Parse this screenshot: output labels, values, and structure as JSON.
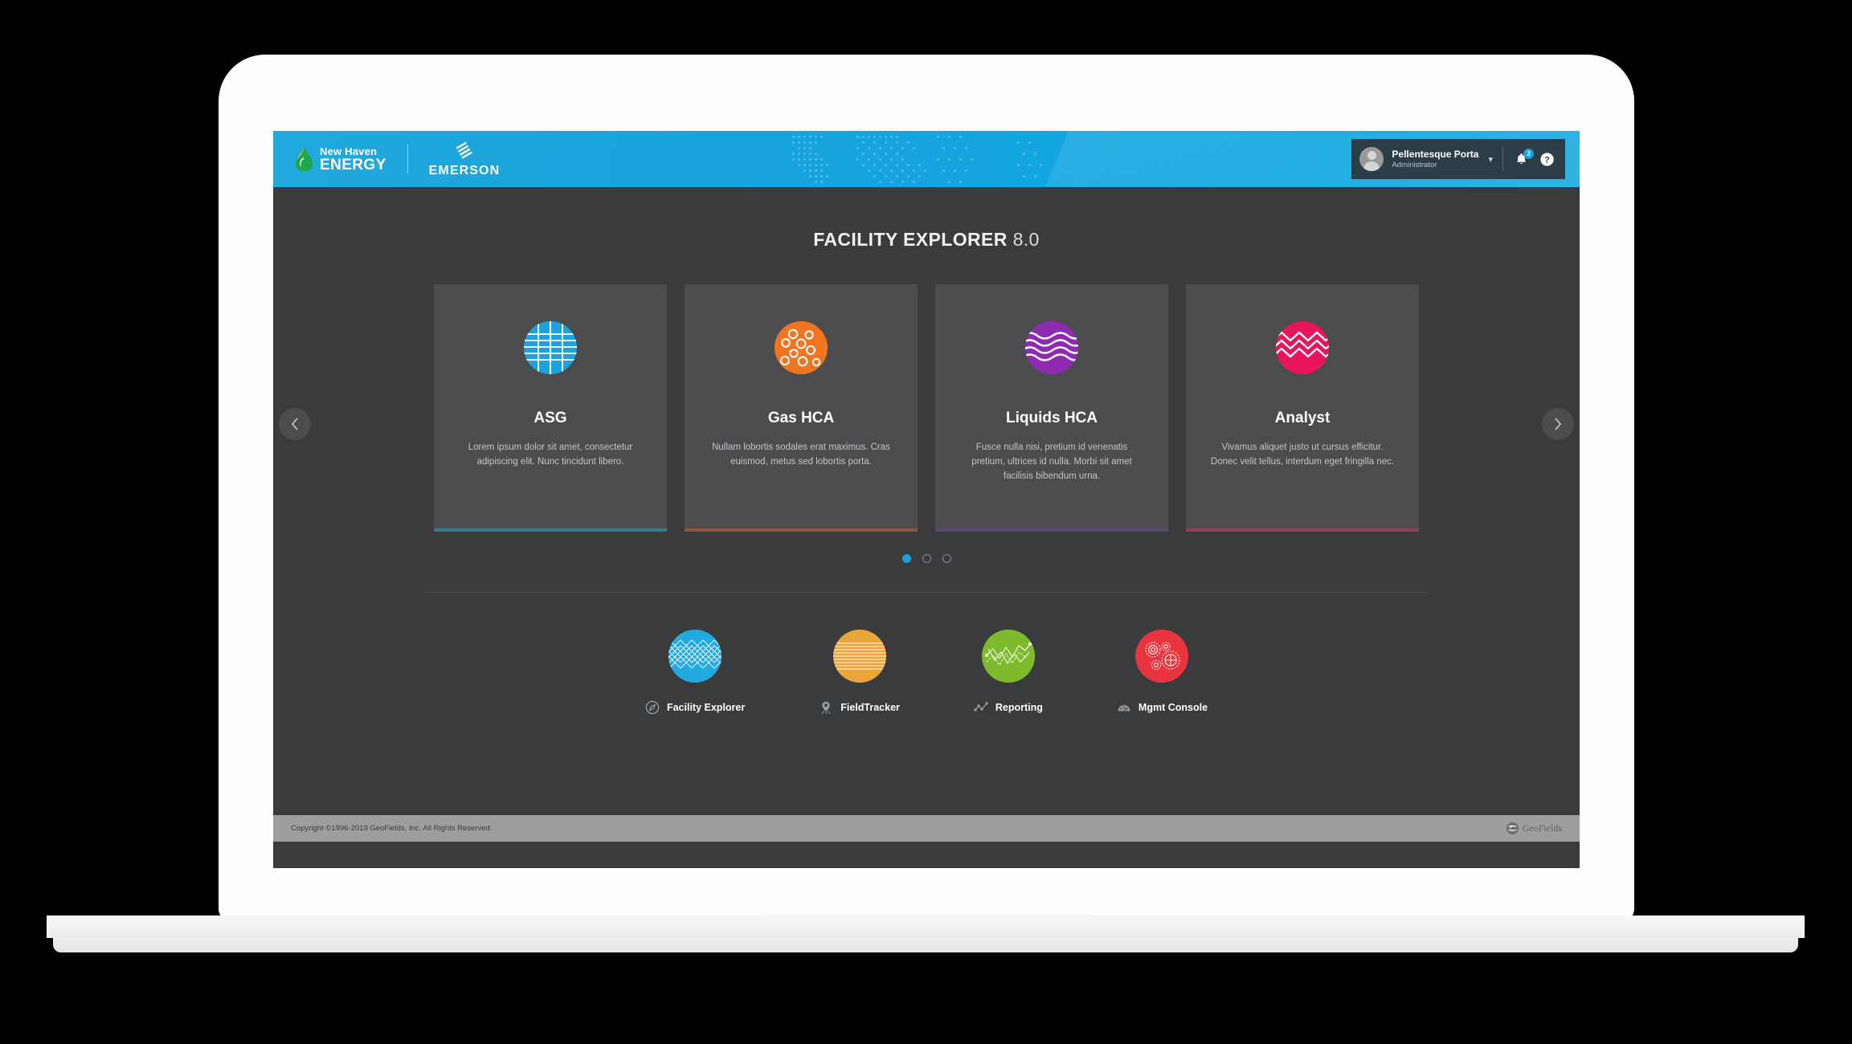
{
  "header": {
    "brand_primary": {
      "line1": "New Haven",
      "line2": "ENERGY",
      "icon": "water-drop-logo"
    },
    "brand_secondary": {
      "name": "EMERSON",
      "icon": "emerson-mark"
    },
    "user": {
      "name": "Pellentesque Porta",
      "role": "Administrator",
      "avatar_icon": "user-avatar",
      "caret_icon": "chevron-down-icon"
    },
    "notifications": {
      "icon": "bell-icon",
      "count": "3"
    },
    "help": {
      "icon": "question-circle-icon"
    },
    "banner_color": "#17a4dd"
  },
  "main": {
    "title_strong": "FACILITY EXPLORER",
    "title_version": "8.0"
  },
  "carousel": {
    "prev_label": "‹",
    "next_label": "›",
    "prev_icon": "chevron-left-icon",
    "next_icon": "chevron-right-icon",
    "dots": [
      {
        "active": true
      },
      {
        "active": false
      },
      {
        "active": false
      }
    ],
    "cards": [
      {
        "title": "ASG",
        "description": "Lorem ipsum dolor sit amet, consectetur adipiscing elit. Nunc tincidunt libero.",
        "icon": "asg-grid-circle-icon",
        "color": "#1aa3e0",
        "accent": "#3b7b8c"
      },
      {
        "title": "Gas HCA",
        "description": "Nullam lobortis sodales erat maximus. Cras euismod, metus sed lobortis porta.",
        "icon": "gas-bubbles-circle-icon",
        "color": "#f1741f",
        "accent": "#8a5a3c"
      },
      {
        "title": "Liquids HCA",
        "description": "Fusce nulla nisi, pretium id venenatis pretium, ultrices id nulla. Morbi sit amet facilisis bibendum urna.",
        "icon": "liquids-waves-circle-icon",
        "color": "#8e2ab0",
        "accent": "#5d4a73"
      },
      {
        "title": "Analyst",
        "description": "Vivamus aliquet justo ut cursus efficitur. Donec velit tellus, interdum eget fringilla nec.",
        "icon": "analyst-zigzag-circle-icon",
        "color": "#e8155c",
        "accent": "#8d4259"
      }
    ]
  },
  "shortcuts": [
    {
      "label": "Facility Explorer",
      "circle_icon": "mesh-diamond-circle-icon",
      "glyph_icon": "compass-icon",
      "color": "#22a9e0"
    },
    {
      "label": "FieldTracker",
      "circle_icon": "horizontal-lines-circle-icon",
      "glyph_icon": "map-pin-icon",
      "color": "#e9a53a"
    },
    {
      "label": "Reporting",
      "circle_icon": "line-chart-circle-icon",
      "glyph_icon": "chart-line-icon",
      "color": "#7dbb2c"
    },
    {
      "label": "Mgmt Console",
      "circle_icon": "gears-circle-icon",
      "glyph_icon": "gauge-icon",
      "color": "#e8343f"
    }
  ],
  "footer": {
    "copyright": "Copyright ©1996-2019 GeoFields, Inc. All Rights Reserved.",
    "logo_text": "GeoFields",
    "logo_icon": "geofields-logo"
  }
}
